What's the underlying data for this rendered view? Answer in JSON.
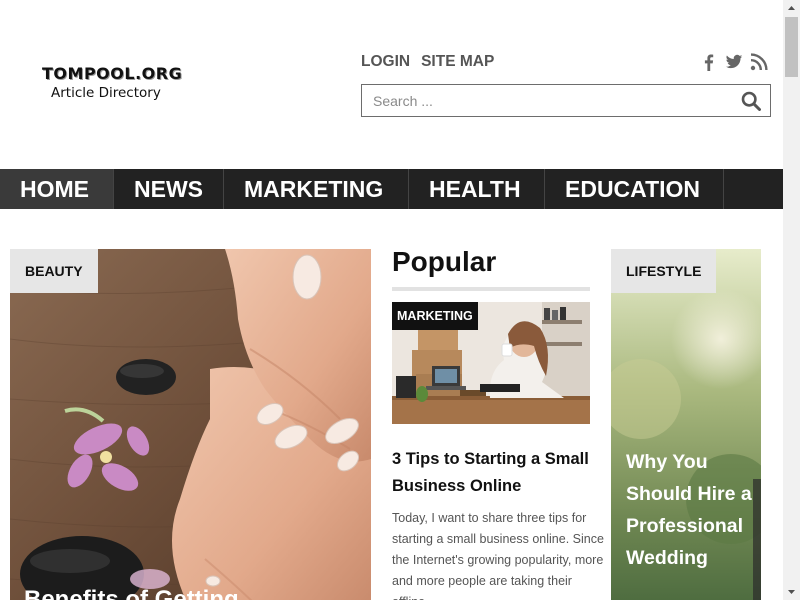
{
  "site": {
    "title": "TOMPOOL.ORG",
    "subtitle": "Article Directory"
  },
  "header": {
    "links": [
      {
        "label": "LOGIN"
      },
      {
        "label": "SITE MAP"
      }
    ],
    "social": [
      "facebook-icon",
      "twitter-icon",
      "rss-icon"
    ],
    "search": {
      "placeholder": "Search ...",
      "value": ""
    }
  },
  "nav": {
    "items": [
      {
        "label": "HOME"
      },
      {
        "label": "NEWS"
      },
      {
        "label": "MARKETING"
      },
      {
        "label": "HEALTH"
      },
      {
        "label": "EDUCATION"
      }
    ],
    "active": "HOME"
  },
  "main": {
    "left_card": {
      "badge": "BEAUTY",
      "title": "Benefits of Getting"
    },
    "popular": {
      "heading": "Popular",
      "badge": "MARKETING",
      "title": "3 Tips to Starting a Small Business Online",
      "excerpt": "Today, I want to share three tips for starting a small business online. Since the Internet's growing popularity, more and more people are taking their offline"
    },
    "right_card": {
      "badge": "LIFESTYLE",
      "title": "Why You Should Hire a Professional Wedding"
    }
  },
  "colors": {
    "nav_bg": "#222222",
    "nav_active": "#3a3a3a",
    "badge_light": "#e6e6e6",
    "badge_dark": "#111111",
    "text_gray": "#555555"
  }
}
